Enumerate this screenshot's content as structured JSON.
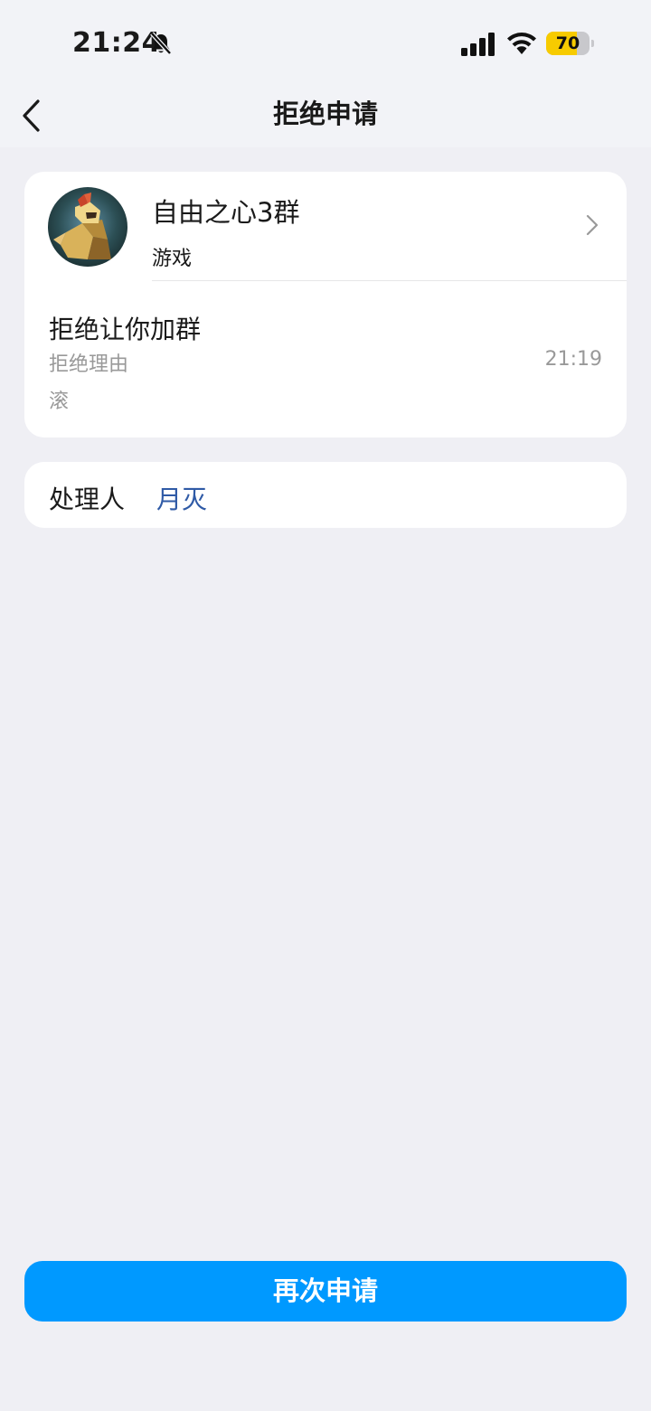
{
  "status_bar": {
    "time": "21:24",
    "battery_level": 70,
    "battery_text": "70",
    "icons": [
      "bell-off-icon",
      "cellular-signal-icon",
      "wifi-icon",
      "battery-icon"
    ]
  },
  "nav": {
    "title": "拒绝申请",
    "back_icon": "chevron-left-icon"
  },
  "group": {
    "name": "自由之心3群",
    "tag": "游戏",
    "chevron_icon": "chevron-right-icon"
  },
  "request": {
    "title": "拒绝让你加群",
    "reason_label": "拒绝理由",
    "time": "21:19",
    "reason": "滚"
  },
  "handler": {
    "label": "处理人",
    "name": "月灭"
  },
  "actions": {
    "reapply_label": "再次申请"
  },
  "colors": {
    "accent": "#0099ff",
    "link": "#2f5aa6",
    "battery": "#f7cb00",
    "secondary_text": "#999999",
    "background": "#efeff4"
  }
}
